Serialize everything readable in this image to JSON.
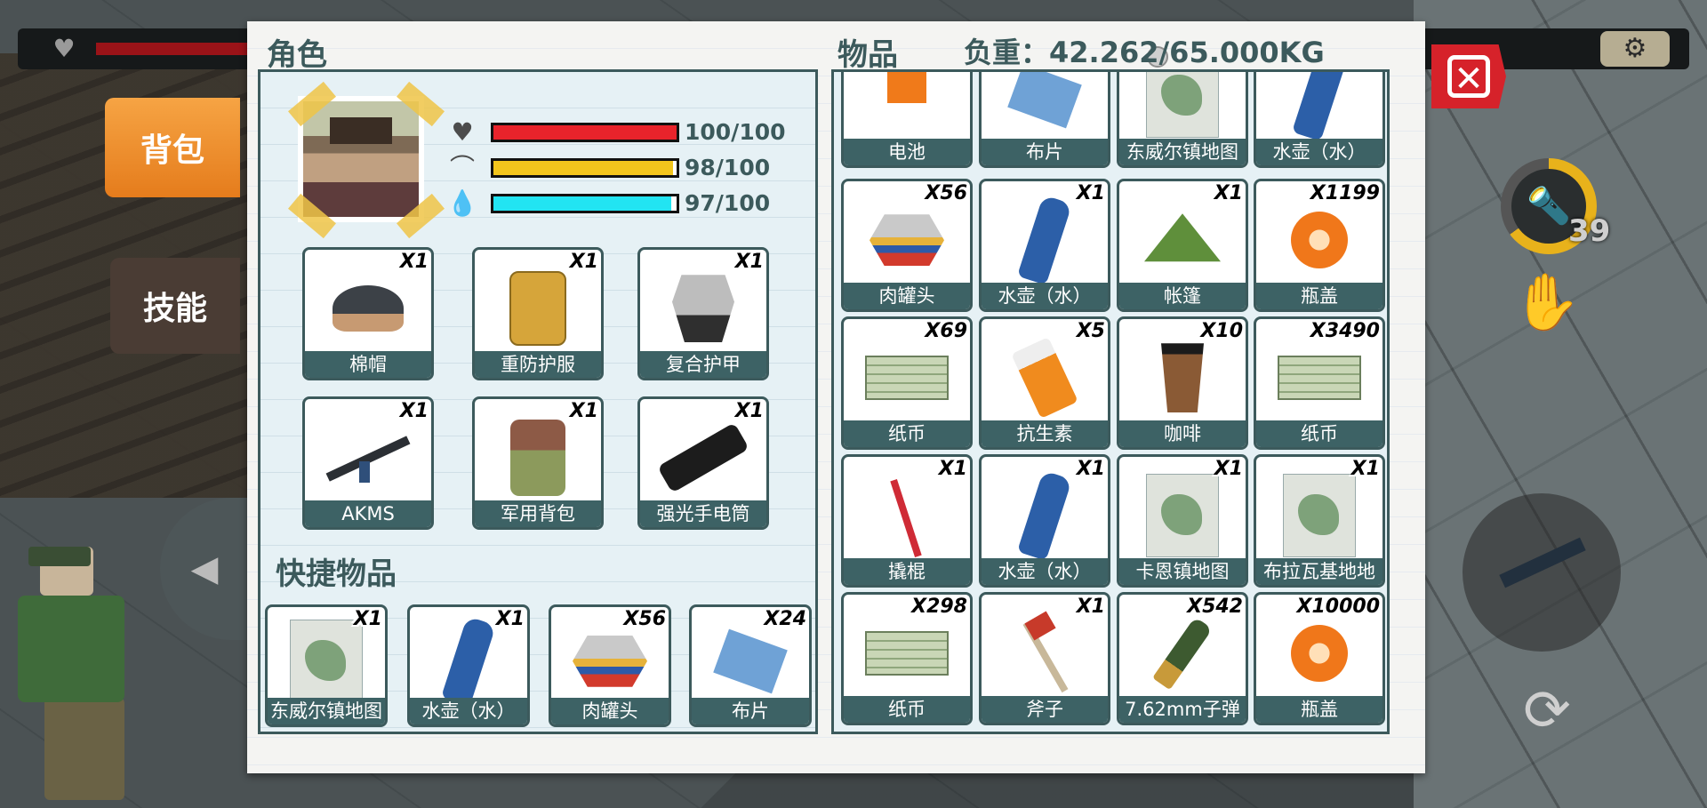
{
  "tabs": {
    "bag": "背包",
    "skill": "技能"
  },
  "character": {
    "title": "角色",
    "stats": [
      {
        "icon": "heart-icon",
        "glyph": "♥",
        "value": "100/100",
        "level": 1.0,
        "color": "#e8232b"
      },
      {
        "icon": "stomach-icon",
        "glyph": "⌒",
        "value": "98/100",
        "level": 0.98,
        "color": "#f2c51c"
      },
      {
        "icon": "water-drop-icon",
        "glyph": "💧",
        "value": "97/100",
        "level": 0.97,
        "color": "#22e4f2"
      }
    ]
  },
  "equipment": [
    {
      "name": "棉帽",
      "qty": "X1",
      "art": "hat"
    },
    {
      "name": "重防护服",
      "qty": "X1",
      "art": "vest"
    },
    {
      "name": "复合护甲",
      "qty": "X1",
      "art": "armor"
    },
    {
      "name": "AKMS",
      "qty": "X1",
      "art": "rifle"
    },
    {
      "name": "军用背包",
      "qty": "X1",
      "art": "pack"
    },
    {
      "name": "强光手电筒",
      "qty": "X1",
      "art": "flash"
    }
  ],
  "quick": {
    "title": "快捷物品",
    "items": [
      {
        "name": "东威尔镇地图",
        "qty": "X1",
        "art": "map"
      },
      {
        "name": "水壶（水）",
        "qty": "X1",
        "art": "bottle"
      },
      {
        "name": "肉罐头",
        "qty": "X56",
        "art": "can"
      },
      {
        "name": "布片",
        "qty": "X24",
        "art": "cloth"
      }
    ]
  },
  "inventory": {
    "title": "物品",
    "weight_label": "负重：42.262/65.000KG",
    "items": [
      {
        "name": "电池",
        "qty": "",
        "art": "battery"
      },
      {
        "name": "布片",
        "qty": "",
        "art": "cloth"
      },
      {
        "name": "东威尔镇地图",
        "qty": "",
        "art": "map"
      },
      {
        "name": "水壶（水）",
        "qty": "",
        "art": "bottle"
      },
      {
        "name": "肉罐头",
        "qty": "X56",
        "art": "can"
      },
      {
        "name": "水壶（水）",
        "qty": "X1",
        "art": "bottle"
      },
      {
        "name": "帐篷",
        "qty": "X1",
        "art": "tent"
      },
      {
        "name": "瓶盖",
        "qty": "X1199",
        "art": "cap"
      },
      {
        "name": "纸币",
        "qty": "X69",
        "art": "money"
      },
      {
        "name": "抗生素",
        "qty": "X5",
        "art": "pills"
      },
      {
        "name": "咖啡",
        "qty": "X10",
        "art": "coffee"
      },
      {
        "name": "纸币",
        "qty": "X3490",
        "art": "money"
      },
      {
        "name": "撬棍",
        "qty": "X1",
        "art": "crowbar"
      },
      {
        "name": "水壶（水）",
        "qty": "X1",
        "art": "bottle"
      },
      {
        "name": "卡恩镇地图",
        "qty": "X1",
        "art": "map"
      },
      {
        "name": "布拉瓦基地地",
        "qty": "X1",
        "art": "map"
      },
      {
        "name": "纸币",
        "qty": "X298",
        "art": "money"
      },
      {
        "name": "斧子",
        "qty": "X1",
        "art": "axe"
      },
      {
        "name": "7.62mm子弹",
        "qty": "X542",
        "art": "bullet"
      },
      {
        "name": "瓶盖",
        "qty": "X10000",
        "art": "cap"
      }
    ]
  },
  "hud": {
    "flashlight_count": "39",
    "flashlight_level": 0.65,
    "close_glyph": "✕",
    "gear_glyph": "⚙",
    "heart_glyph": "♥",
    "hand_glyph": "✋",
    "reload_glyph": "⟳",
    "left_arrow_glyph": "◀"
  }
}
